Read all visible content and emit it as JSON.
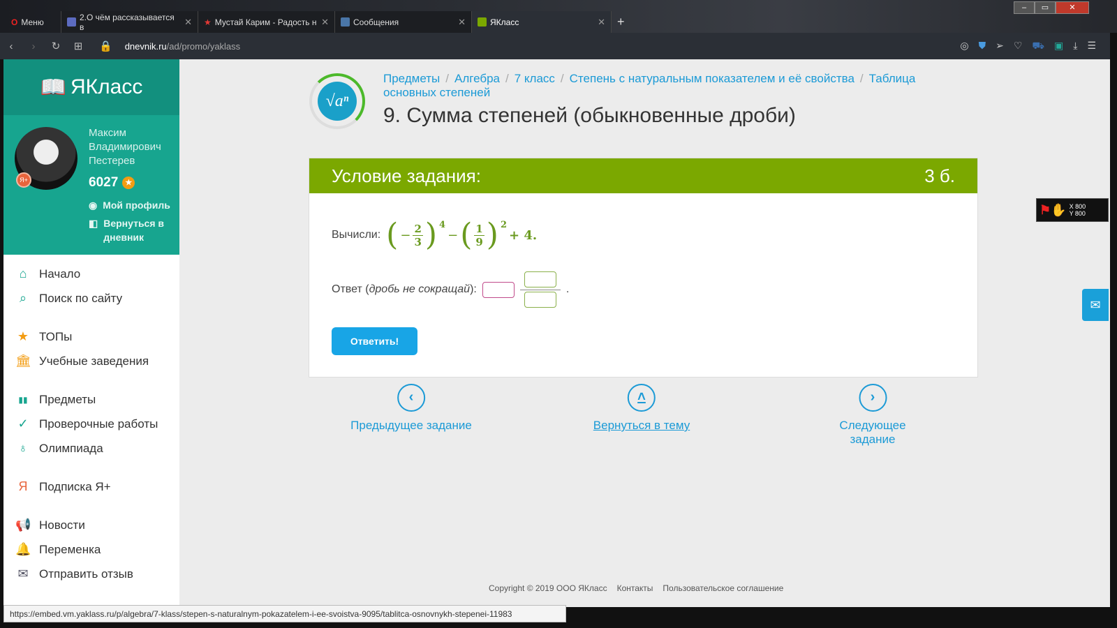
{
  "browser": {
    "menu": "Меню",
    "tabs": [
      {
        "label": "2.О чём рассказывается в",
        "color": "#5c6bc0"
      },
      {
        "label": "Мустай Карим - Радость н",
        "color": "#e53935"
      },
      {
        "label": "Сообщения",
        "color": "#4a76a8"
      },
      {
        "label": "ЯКласс",
        "color": "#7ba800"
      }
    ],
    "url_domain": "dnevnik.ru",
    "url_path": "/ad/promo/yaklass"
  },
  "sidebar": {
    "brand": "ЯКласс",
    "user": {
      "first": "Максим",
      "middle": "Владимирович",
      "last": "Пестерев",
      "badge": "Я+",
      "score": "6027"
    },
    "links": {
      "profile": "Мой профиль",
      "diary": "Вернуться в дневник"
    },
    "items": [
      {
        "label": "Начало",
        "icon": "⌂"
      },
      {
        "label": "Поиск по сайту",
        "icon": "⌕"
      },
      {
        "label": "ТОПы",
        "icon": "★"
      },
      {
        "label": "Учебные заведения",
        "icon": "🏛"
      },
      {
        "label": "Предметы",
        "icon": "▮▮"
      },
      {
        "label": "Проверочные работы",
        "icon": "✓"
      },
      {
        "label": "Олимпиада",
        "icon": "♁"
      },
      {
        "label": "Подписка Я+",
        "icon": "Я"
      },
      {
        "label": "Новости",
        "icon": "📢"
      },
      {
        "label": "Переменка",
        "icon": "🔔"
      },
      {
        "label": "Отправить отзыв",
        "icon": "✉"
      }
    ]
  },
  "breadcrumbs": [
    "Предметы",
    "Алгебра",
    "7 класс",
    "Степень с натуральным показателем и её свойства",
    "Таблица основных степеней"
  ],
  "title": "9. Сумма степеней (обыкновенные дроби)",
  "task": {
    "header": "Условие задания:",
    "points": "3 б.",
    "prompt": "Вычисли:",
    "f1n": "2",
    "f1d": "3",
    "e1": "4",
    "f2n": "1",
    "f2d": "9",
    "e2": "2",
    "tail": "+ 4.",
    "answer_label": "Ответ (",
    "answer_hint": "дробь не сокращай",
    "answer_end": "):",
    "submit": "Ответить!"
  },
  "nav": {
    "prev": "Предыдущее задание",
    "up": "Вернуться в тему",
    "next": "Следующее задание"
  },
  "footer": {
    "copyright": "Copyright © 2019 ООО ЯКласс",
    "contacts": "Контакты",
    "agreement": "Пользовательское соглашение"
  },
  "status_url": "https://embed.vm.yaklass.ru/p/algebra/7-klass/stepen-s-naturalnym-pokazatelem-i-ee-svoistva-9095/tablitca-osnovnykh-stepenei-11983",
  "widget": {
    "x": "X 800",
    "y": "Y 800"
  }
}
